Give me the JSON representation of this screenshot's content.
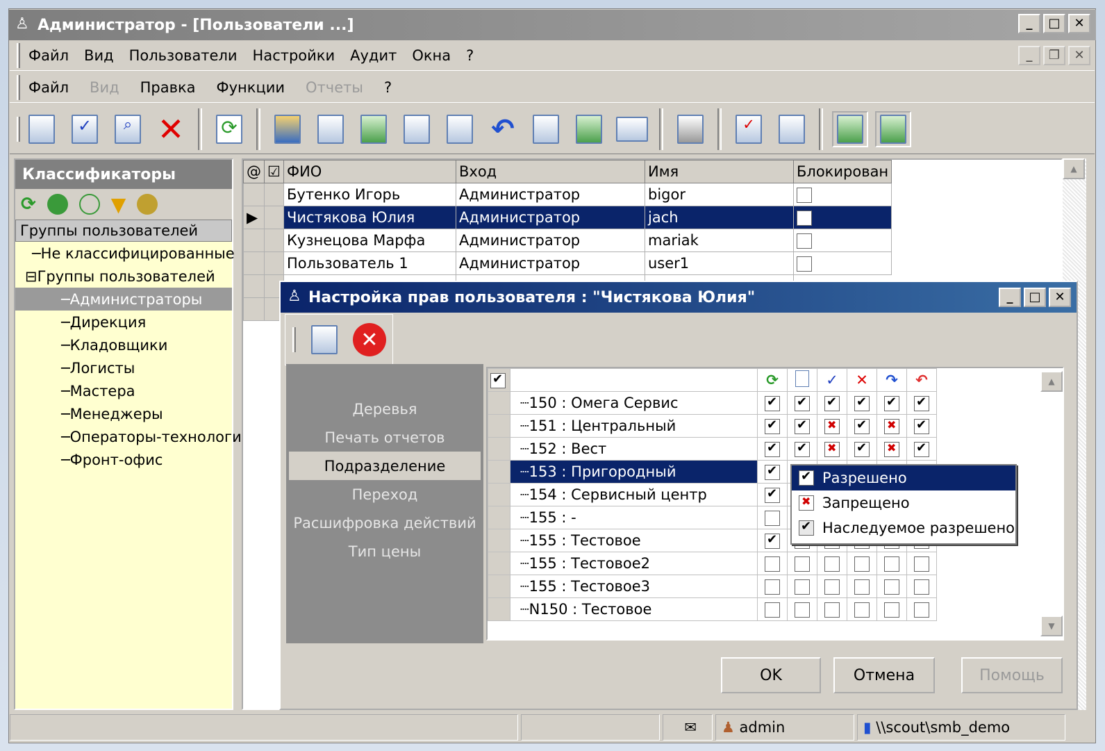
{
  "window": {
    "title": "Администратор - [Пользователи ...]"
  },
  "menu1": [
    "Файл",
    "Вид",
    "Пользователи",
    "Настройки",
    "Аудит",
    "Окна",
    "?"
  ],
  "menu2": [
    {
      "label": "Файл",
      "enabled": true
    },
    {
      "label": "Вид",
      "enabled": false
    },
    {
      "label": "Правка",
      "enabled": true
    },
    {
      "label": "Функции",
      "enabled": true
    },
    {
      "label": "Отчеты",
      "enabled": false
    },
    {
      "label": "?",
      "enabled": true
    }
  ],
  "left_panel": {
    "header": "Классификаторы",
    "group_label": "Группы пользователей",
    "tree": {
      "unclassified": "Не классифицированные",
      "root": "Группы пользователей",
      "expander": "⊟",
      "children": [
        "Администраторы",
        "Дирекция",
        "Кладовщики",
        "Логисты",
        "Мастера",
        "Менеджеры",
        "Операторы-технологи",
        "Фронт-офис"
      ],
      "selected_index": 0
    }
  },
  "users_grid": {
    "headers": {
      "attach": "@",
      "check": "☑",
      "fio": "ФИО",
      "login": "Вход",
      "name": "Имя",
      "blocked": "Блокирован"
    },
    "rows": [
      {
        "fio": "Бутенко Игорь",
        "login": "Администратор",
        "name": "bigor",
        "blocked": false
      },
      {
        "fio": "Чистякова Юлия",
        "login": "Администратор",
        "name": "jach",
        "blocked": false
      },
      {
        "fio": "Кузнецова Марфа",
        "login": "Администратор",
        "name": "mariak",
        "blocked": false
      },
      {
        "fio": "Пользователь 1",
        "login": "Администратор",
        "name": "user1",
        "blocked": false
      }
    ],
    "selected_index": 1,
    "row_indicator": "▶"
  },
  "dialog": {
    "title": "Настройка прав пользователя : \"Чистякова Юлия\"",
    "categories": [
      "Деревья",
      "Печать отчетов",
      "Подразделение",
      "Переход",
      "Расшифровка действий",
      "Тип цены"
    ],
    "active_category_index": 2,
    "rights_rows": [
      {
        "name": "150 : Омега Сервис",
        "v": [
          "c",
          "c",
          "c",
          "c",
          "c",
          "c"
        ]
      },
      {
        "name": "151 : Центральный",
        "v": [
          "c",
          "c",
          "x",
          "c",
          "x",
          "c"
        ]
      },
      {
        "name": "152 : Вест",
        "v": [
          "c",
          "c",
          "x",
          "c",
          "x",
          "c"
        ]
      },
      {
        "name": "153 : Пригородный",
        "v": [
          "c",
          "",
          "",
          "",
          "",
          ""
        ]
      },
      {
        "name": "154 : Сервисный центр",
        "v": [
          "c",
          "",
          "",
          "",
          "",
          ""
        ]
      },
      {
        "name": "155 : -",
        "v": [
          "",
          "",
          "",
          "",
          "",
          ""
        ]
      },
      {
        "name": "155 : Тестовое",
        "v": [
          "c",
          "",
          "",
          "",
          "",
          ""
        ]
      },
      {
        "name": "155 : Тестовое2",
        "v": [
          "",
          "",
          "",
          "",
          "",
          ""
        ]
      },
      {
        "name": "155 : Тестовое3",
        "v": [
          "",
          "",
          "",
          "",
          "",
          ""
        ]
      },
      {
        "name": "N150 : Тестовое",
        "v": [
          "",
          "",
          "",
          "",
          "",
          ""
        ]
      }
    ],
    "selected_row_index": 3,
    "popup": {
      "allowed": "Разрешено",
      "denied": "Запрещено",
      "inherited": "Наследуемое разрешено"
    },
    "buttons": {
      "ok": "OK",
      "cancel": "Отмена",
      "help": "Помощь"
    }
  },
  "status": {
    "user": "admin",
    "path": "\\\\scout\\smb_demo"
  },
  "colors": {
    "selection": "#0a246a",
    "tree_bg": "#ffffd0",
    "face": "#d4d0c8"
  }
}
